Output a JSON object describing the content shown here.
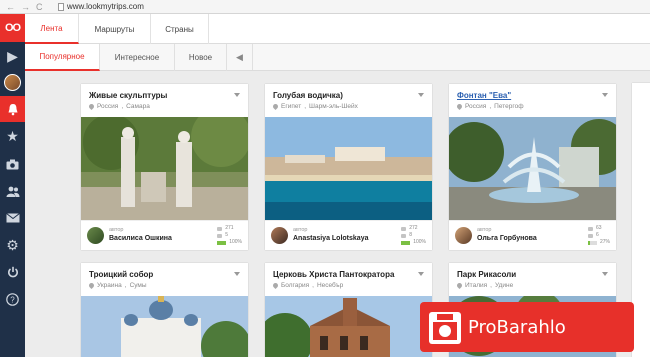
{
  "browser": {
    "url": "www.lookmytrips.com",
    "back_icon": "arrow-left-icon",
    "forward_icon": "arrow-right-icon",
    "reload_icon": "reload-icon"
  },
  "brand": {
    "logo": "OO",
    "color": "#e9302b",
    "sidebar_color": "#1f3048"
  },
  "sidebar": [
    {
      "name": "play-icon",
      "glyph": "▶"
    },
    {
      "name": "user-avatar",
      "glyph": ""
    },
    {
      "name": "bell-icon",
      "glyph": "🔔"
    },
    {
      "name": "star-icon",
      "glyph": "★"
    },
    {
      "name": "camera-icon",
      "glyph": "📷"
    },
    {
      "name": "people-icon",
      "glyph": "👥"
    },
    {
      "name": "mail-icon",
      "glyph": "✉"
    },
    {
      "name": "settings-icon",
      "glyph": "⚙"
    },
    {
      "name": "power-icon",
      "glyph": "⏻"
    },
    {
      "name": "help-icon",
      "glyph": "?"
    }
  ],
  "tabs": [
    "Лента",
    "Маршруты",
    "Страны"
  ],
  "subtabs": [
    "Популярное",
    "Интересное",
    "Новое"
  ],
  "cards": [
    {
      "title": "Живые скульптуры",
      "country": "Россия",
      "city": "Самара",
      "author_label": "автор",
      "author": "Василиса Ошкина",
      "views": "271",
      "likes": "5",
      "progress": "100%",
      "progress_value": 1.0
    },
    {
      "title": "Голубая водичка)",
      "country": "Египет",
      "city": "Шарм-эль-Шейх",
      "author_label": "автор",
      "author": "Anastasiya Lolotskaya",
      "views": "272",
      "likes": "8",
      "progress": "100%",
      "progress_value": 1.0
    },
    {
      "title": "Фонтан \"Ева\"",
      "country": "Россия",
      "city": "Петергоф",
      "author_label": "автор",
      "author": "Ольга Горбунова",
      "views": "63",
      "likes": "6",
      "progress": "27%",
      "progress_value": 0.27
    },
    {
      "title": "Троицкий собор",
      "country": "Украина",
      "city": "Сумы"
    },
    {
      "title": "Церковь Христа Пантократора",
      "country": "Болгария",
      "city": "Несебър"
    },
    {
      "title": "Парк Рикасоли",
      "country": "Италия",
      "city": "Удине"
    }
  ],
  "watermark": {
    "text": "ProBarahlo"
  }
}
